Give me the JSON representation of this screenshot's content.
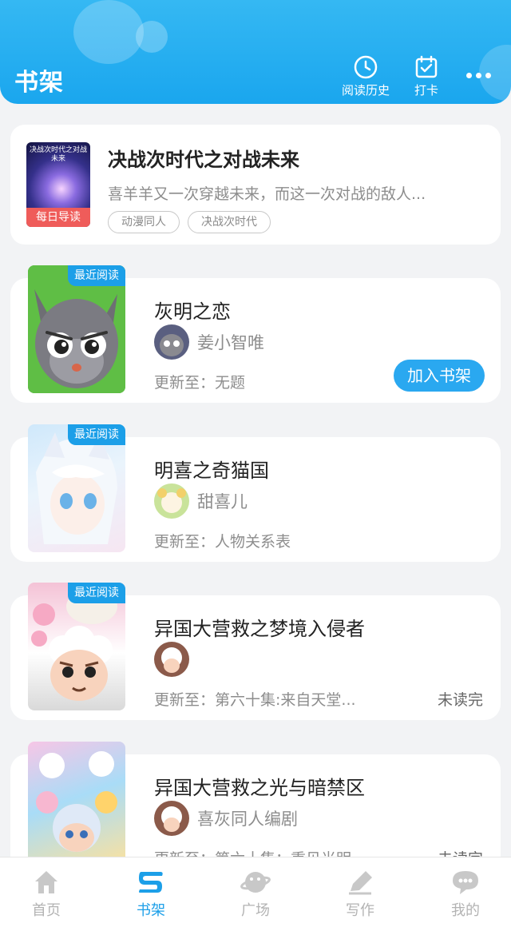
{
  "header": {
    "title": "书架",
    "history_label": "阅读历史",
    "checkin_label": "打卡"
  },
  "featured": {
    "cover_text": "决战次时代之对战未来",
    "cover_tag": "每日导读",
    "title": "决战次时代之对战未来",
    "description": "喜羊羊又一次穿越未来，而这一次对战的敌人...",
    "tags": [
      "动漫同人",
      "决战次时代"
    ]
  },
  "books": [
    {
      "badge": "最近阅读",
      "title": "灰明之恋",
      "author": "姜小智唯",
      "update": "更新至：无题",
      "action": "加入书架"
    },
    {
      "badge": "最近阅读",
      "title": "明喜之奇猫国",
      "author": "甜喜儿",
      "update": "更新至：人物关系表"
    },
    {
      "badge": "最近阅读",
      "title": "异国大营救之梦境入侵者",
      "author": "",
      "update": "更新至：第六十集:来自天堂...",
      "status": "未读完"
    },
    {
      "title": "异国大营救之光与暗禁区",
      "author": "喜灰同人编剧",
      "update": "更新至：第六十集：重见光明",
      "status": "未读完"
    }
  ],
  "tabs": [
    {
      "label": "首页",
      "icon": "home-icon"
    },
    {
      "label": "书架",
      "icon": "bookshelf-icon",
      "active": true
    },
    {
      "label": "广场",
      "icon": "planet-icon"
    },
    {
      "label": "写作",
      "icon": "pen-icon"
    },
    {
      "label": "我的",
      "icon": "chat-bubble-icon"
    }
  ],
  "colors": {
    "accent": "#1c9fe8",
    "header": "#2bb0f1",
    "tag_red": "#ef5c5a"
  }
}
